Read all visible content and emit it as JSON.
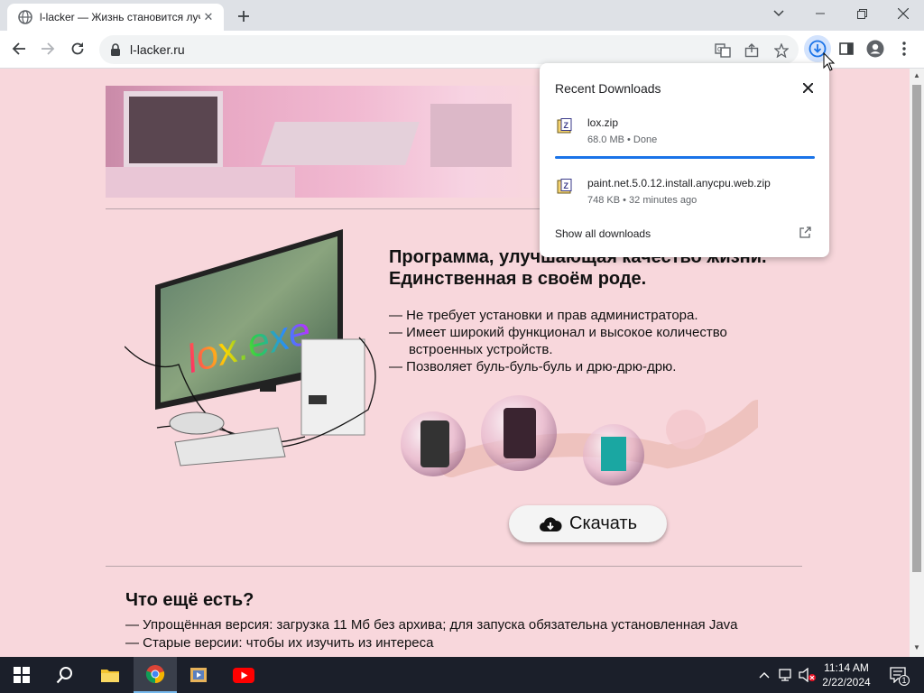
{
  "browser": {
    "tab": {
      "title": "l-lacker — Жизнь становится лучше"
    },
    "omnibox": {
      "url": "l-lacker.ru"
    }
  },
  "downloads_popup": {
    "title": "Recent Downloads",
    "items": [
      {
        "name": "lox.zip",
        "meta": "68.0 MB • Done"
      },
      {
        "name": "paint.net.5.0.12.install.anycpu.web.zip",
        "meta": "748 KB • 32 minutes ago"
      }
    ],
    "show_all": "Show all downloads"
  },
  "page": {
    "heading_line1": "Программа, улучшающая качество жизни.",
    "heading_line2": "Единственная в своём роде.",
    "features": [
      "— Не требует установки и прав администратора.",
      "— Имеет широкий функционал и высокое количество",
      "встроенных устройств.",
      "— Позволяет буль-буль-буль и дрю-дрю-дрю."
    ],
    "hero_caption": "lox.exe",
    "download_button": "Скачать",
    "other_heading": "Что ещё есть?",
    "other_items": [
      "— Упрощённая версия: загрузка 11 Мб без архива; для запуска обязательна установленная Java",
      "— Старые версии: чтобы их изучить из интереса"
    ]
  },
  "taskbar": {
    "time": "11:14 AM",
    "date": "2/22/2024",
    "notification_count": "1"
  }
}
